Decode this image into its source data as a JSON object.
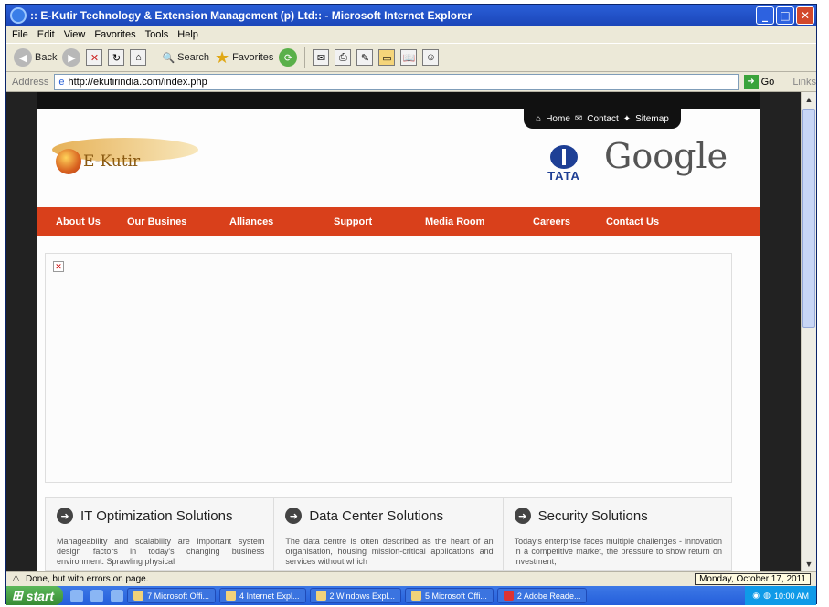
{
  "window": {
    "title": ":: E-Kutir Technology & Extension Management (p) Ltd:: - Microsoft Internet Explorer",
    "controls": [
      "_",
      "□",
      "✕"
    ]
  },
  "menu": [
    "File",
    "Edit",
    "View",
    "Favorites",
    "Tools",
    "Help"
  ],
  "toolbar": {
    "back": "Back",
    "search": "Search",
    "favorites": "Favorites"
  },
  "address": {
    "label": "Address",
    "url": "http://ekutirindia.com/index.php",
    "go": "Go",
    "links": "Links"
  },
  "site": {
    "top_links": [
      "Home",
      "Contact",
      "Sitemap"
    ],
    "logo_text": "E-Kutir",
    "partner_tata": "TATA",
    "partner_google": "Google",
    "nav": [
      "About Us",
      "Our Busines",
      "Alliances",
      "Support",
      "Media Room",
      "Careers",
      "Contact Us"
    ],
    "solutions": [
      {
        "title": "IT Optimization Solutions",
        "text": "Manageability and scalability are important system design factors in today's changing business environment. Sprawling physical"
      },
      {
        "title": "Data Center Solutions",
        "text": "The data centre is often described as the heart of an organisation, housing mission-critical applications and services without which"
      },
      {
        "title": "Security Solutions",
        "text": "Today's enterprise faces multiple challenges - innovation in a competitive market, the pressure to show return on investment,"
      }
    ]
  },
  "status": {
    "text": "Done, but with errors on page.",
    "date_tooltip": "Monday, October 17, 2011"
  },
  "taskbar": {
    "start": "start",
    "tasks": [
      "7 Microsoft Offi...",
      "4 Internet Expl...",
      "2 Windows Expl...",
      "5 Microsoft Offi...",
      "2 Adobe Reade..."
    ],
    "clock": "10:00 AM"
  }
}
